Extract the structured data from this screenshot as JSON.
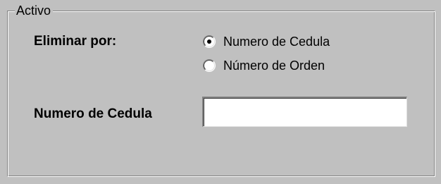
{
  "group": {
    "title": "Activo"
  },
  "form": {
    "delete_by_label": "Eliminar por:",
    "options": [
      {
        "label": "Numero de Cedula",
        "selected": true
      },
      {
        "label": "Número de Orden",
        "selected": false
      }
    ],
    "cedula_label": "Numero de Cedula",
    "cedula_value": ""
  },
  "colors": {
    "background": "#c0c0c0",
    "field_background": "#ffffff"
  }
}
